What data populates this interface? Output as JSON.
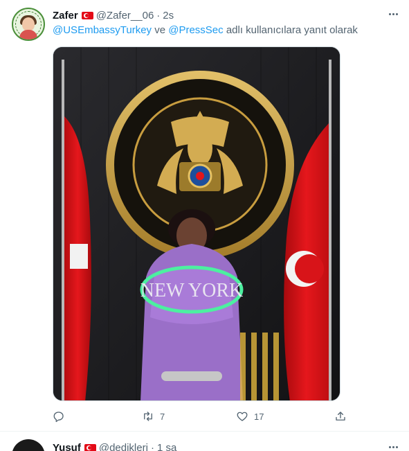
{
  "tweet": {
    "author_name": "Zafer",
    "author_handle": "@Zafer__06",
    "separator": "·",
    "time": "2s",
    "reply_to_1": "@USEmbassyTurkey",
    "reply_connector": " ve ",
    "reply_to_2": "@PressSec",
    "reply_suffix": " adlı kullanıcılara yanıt olarak",
    "media_annotation_text": "NEW YORK",
    "actions": {
      "retweets": "7",
      "likes": "17"
    }
  },
  "next_tweet": {
    "author_name": "Yusuf",
    "author_handle": "@dedikleri",
    "separator": "·",
    "time": "1 sa"
  },
  "colors": {
    "link": "#1d9bf0",
    "secondary_text": "#536471",
    "turkish_flag": "#e30a17",
    "annotation": "#4cf0a0"
  },
  "icons": [
    "flag-tr-icon",
    "more-icon",
    "reply-icon",
    "retweet-icon",
    "like-icon",
    "share-icon"
  ]
}
